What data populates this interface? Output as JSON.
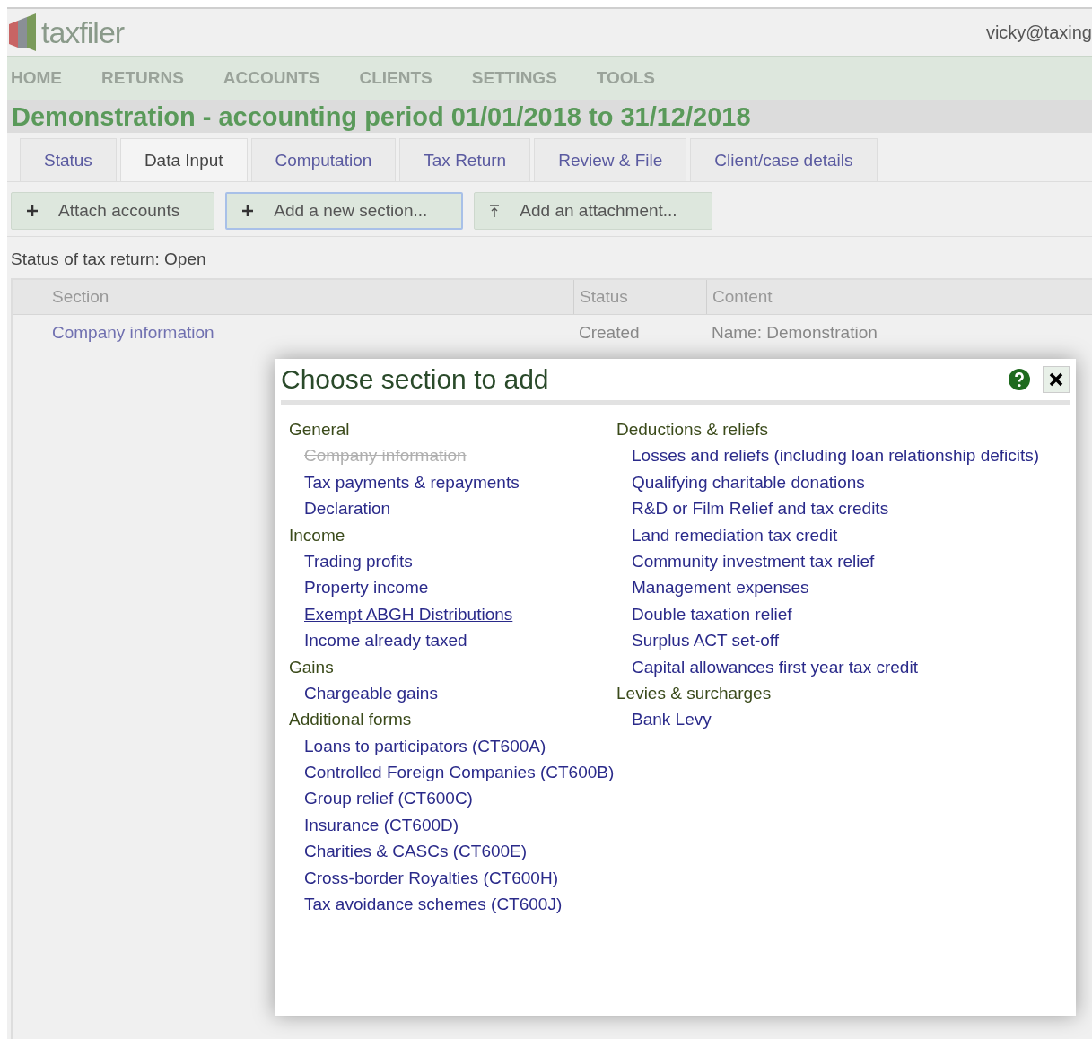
{
  "header": {
    "logo": "taxfiler",
    "user": "vicky@taxing"
  },
  "nav": [
    "HOME",
    "RETURNS",
    "ACCOUNTS",
    "CLIENTS",
    "SETTINGS",
    "TOOLS"
  ],
  "title": "Demonstration - accounting period 01/01/2018 to 31/12/2018",
  "tabs": [
    {
      "label": "Status",
      "selected": false
    },
    {
      "label": "Data Input",
      "selected": true
    },
    {
      "label": "Computation",
      "selected": false
    },
    {
      "label": "Tax Return",
      "selected": false
    },
    {
      "label": "Review & File",
      "selected": false
    },
    {
      "label": "Client/case details",
      "selected": false
    }
  ],
  "actions": [
    {
      "label": "Attach accounts",
      "kind": "plus",
      "focused": false
    },
    {
      "label": "Add a new section...",
      "kind": "plus",
      "focused": true
    },
    {
      "label": "Add an attachment...",
      "kind": "upload",
      "focused": false
    }
  ],
  "status_text": "Status of tax return: Open",
  "table": {
    "columns": [
      "Section",
      "Status",
      "Content"
    ],
    "rows": [
      [
        "Company information",
        "Created",
        "Name: Demonstration"
      ]
    ]
  },
  "dialog": {
    "title": "Choose section to add",
    "columns": [
      [
        {
          "heading": "General",
          "items": [
            {
              "label": "Company information",
              "disabled": true,
              "hovered": false
            },
            {
              "label": "Tax payments & repayments",
              "disabled": false,
              "hovered": false
            },
            {
              "label": "Declaration",
              "disabled": false,
              "hovered": false
            }
          ]
        },
        {
          "heading": "Income",
          "items": [
            {
              "label": "Trading profits",
              "disabled": false,
              "hovered": false
            },
            {
              "label": "Property income",
              "disabled": false,
              "hovered": false
            },
            {
              "label": "Exempt ABGH Distributions",
              "disabled": false,
              "hovered": true
            },
            {
              "label": "Income already taxed",
              "disabled": false,
              "hovered": false
            }
          ]
        },
        {
          "heading": "Gains",
          "items": [
            {
              "label": "Chargeable gains",
              "disabled": false,
              "hovered": false
            }
          ]
        },
        {
          "heading": "Additional forms",
          "items": [
            {
              "label": "Loans to participators (CT600A)",
              "disabled": false,
              "hovered": false
            },
            {
              "label": "Controlled Foreign Companies (CT600B)",
              "disabled": false,
              "hovered": false
            },
            {
              "label": "Group relief (CT600C)",
              "disabled": false,
              "hovered": false
            },
            {
              "label": "Insurance (CT600D)",
              "disabled": false,
              "hovered": false
            },
            {
              "label": "Charities & CASCs (CT600E)",
              "disabled": false,
              "hovered": false
            },
            {
              "label": "Cross-border Royalties (CT600H)",
              "disabled": false,
              "hovered": false
            },
            {
              "label": "Tax avoidance schemes (CT600J)",
              "disabled": false,
              "hovered": false
            }
          ]
        }
      ],
      [
        {
          "heading": "Deductions & reliefs",
          "items": [
            {
              "label": "Losses and reliefs (including loan relationship deficits)",
              "disabled": false,
              "hovered": false
            },
            {
              "label": "Qualifying charitable donations",
              "disabled": false,
              "hovered": false
            },
            {
              "label": "R&D or Film Relief and tax credits",
              "disabled": false,
              "hovered": false
            },
            {
              "label": "Land remediation tax credit",
              "disabled": false,
              "hovered": false
            },
            {
              "label": "Community investment tax relief",
              "disabled": false,
              "hovered": false
            },
            {
              "label": "Management expenses",
              "disabled": false,
              "hovered": false
            },
            {
              "label": "Double taxation relief",
              "disabled": false,
              "hovered": false
            },
            {
              "label": "Surplus ACT set-off",
              "disabled": false,
              "hovered": false
            },
            {
              "label": "Capital allowances first year tax credit",
              "disabled": false,
              "hovered": false
            }
          ]
        },
        {
          "heading": "Levies & surcharges",
          "items": [
            {
              "label": "Bank Levy",
              "disabled": false,
              "hovered": false
            }
          ]
        }
      ]
    ]
  }
}
